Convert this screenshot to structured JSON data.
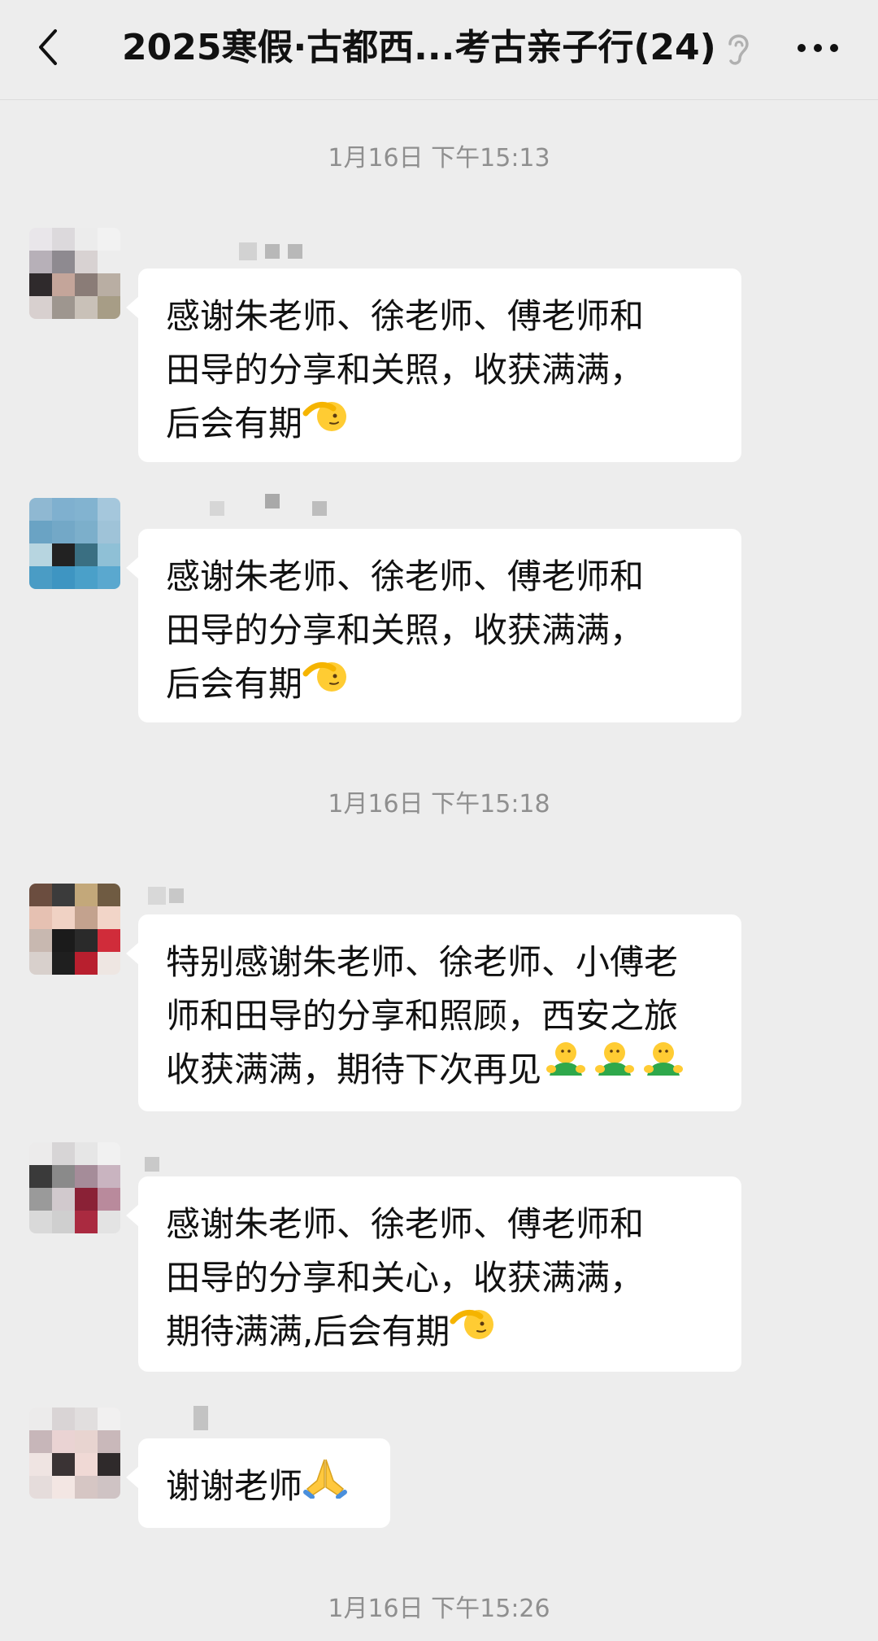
{
  "header": {
    "title": "2025寒假·古都西...考古亲子行(24)",
    "back_icon": "chevron-left-icon",
    "ear_icon": "ear-icon",
    "more_icon": "more-dots-icon"
  },
  "timestamps": [
    "1月16日 下午15:13",
    "1月16日 下午15:18",
    "1月16日 下午15:26"
  ],
  "messages": [
    {
      "lines": "感谢朱老师、徐老师、傅老师和\n田导的分享和关照，收获满满，\n后会有期",
      "emoji": "saluting-face-icon"
    },
    {
      "lines": "感谢朱老师、徐老师、傅老师和\n田导的分享和关照，收获满满，\n后会有期",
      "emoji": "saluting-face-icon"
    },
    {
      "lines": "特别感谢朱老师、徐老师、小傅老\n师和田导的分享和照顾，西安之旅\n收获满满，期待下次再见",
      "emoji": "hugging-figure-icon"
    },
    {
      "lines": "感谢朱老师、徐老师、傅老师和\n田导的分享和关心，收获满满，\n期待满满,后会有期",
      "emoji": "saluting-face-icon"
    },
    {
      "lines": "谢谢老师",
      "emoji": "folded-hands-icon"
    }
  ],
  "colors": {
    "background": "#ededed",
    "bubble": "#ffffff",
    "timestamp": "#8f8f8f"
  }
}
